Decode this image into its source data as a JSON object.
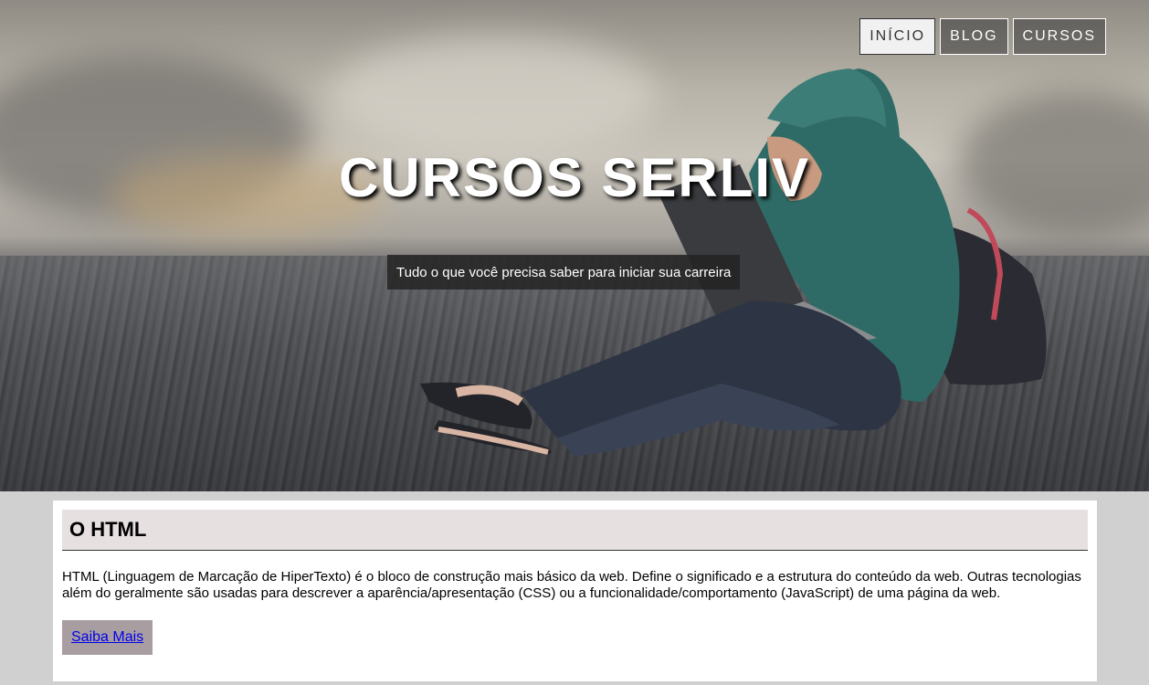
{
  "nav": {
    "items": [
      {
        "label": "INÍCIO",
        "active": true
      },
      {
        "label": "BLOG",
        "active": false
      },
      {
        "label": "CURSOS",
        "active": false
      }
    ]
  },
  "hero": {
    "title": "CURSOS SERLIV",
    "subtitle": "Tudo o que você precisa saber para iniciar sua carreira"
  },
  "section": {
    "heading": "O HTML",
    "text": "HTML (Linguagem de Marcação de HiperTexto) é o bloco de construção mais básico da web. Define o significado e a estrutura do conteúdo da web. Outras tecnologias além do geralmente são usadas para descrever a aparência/apresentação (CSS) ou a funcionalidade/comportamento (JavaScript) de uma página da web.",
    "button_label": "Saiba Mais"
  },
  "colors": {
    "section_heading_bg": "#e6e0e1",
    "button_bg": "#a89ea1",
    "page_bg": "#d0d0d0"
  }
}
